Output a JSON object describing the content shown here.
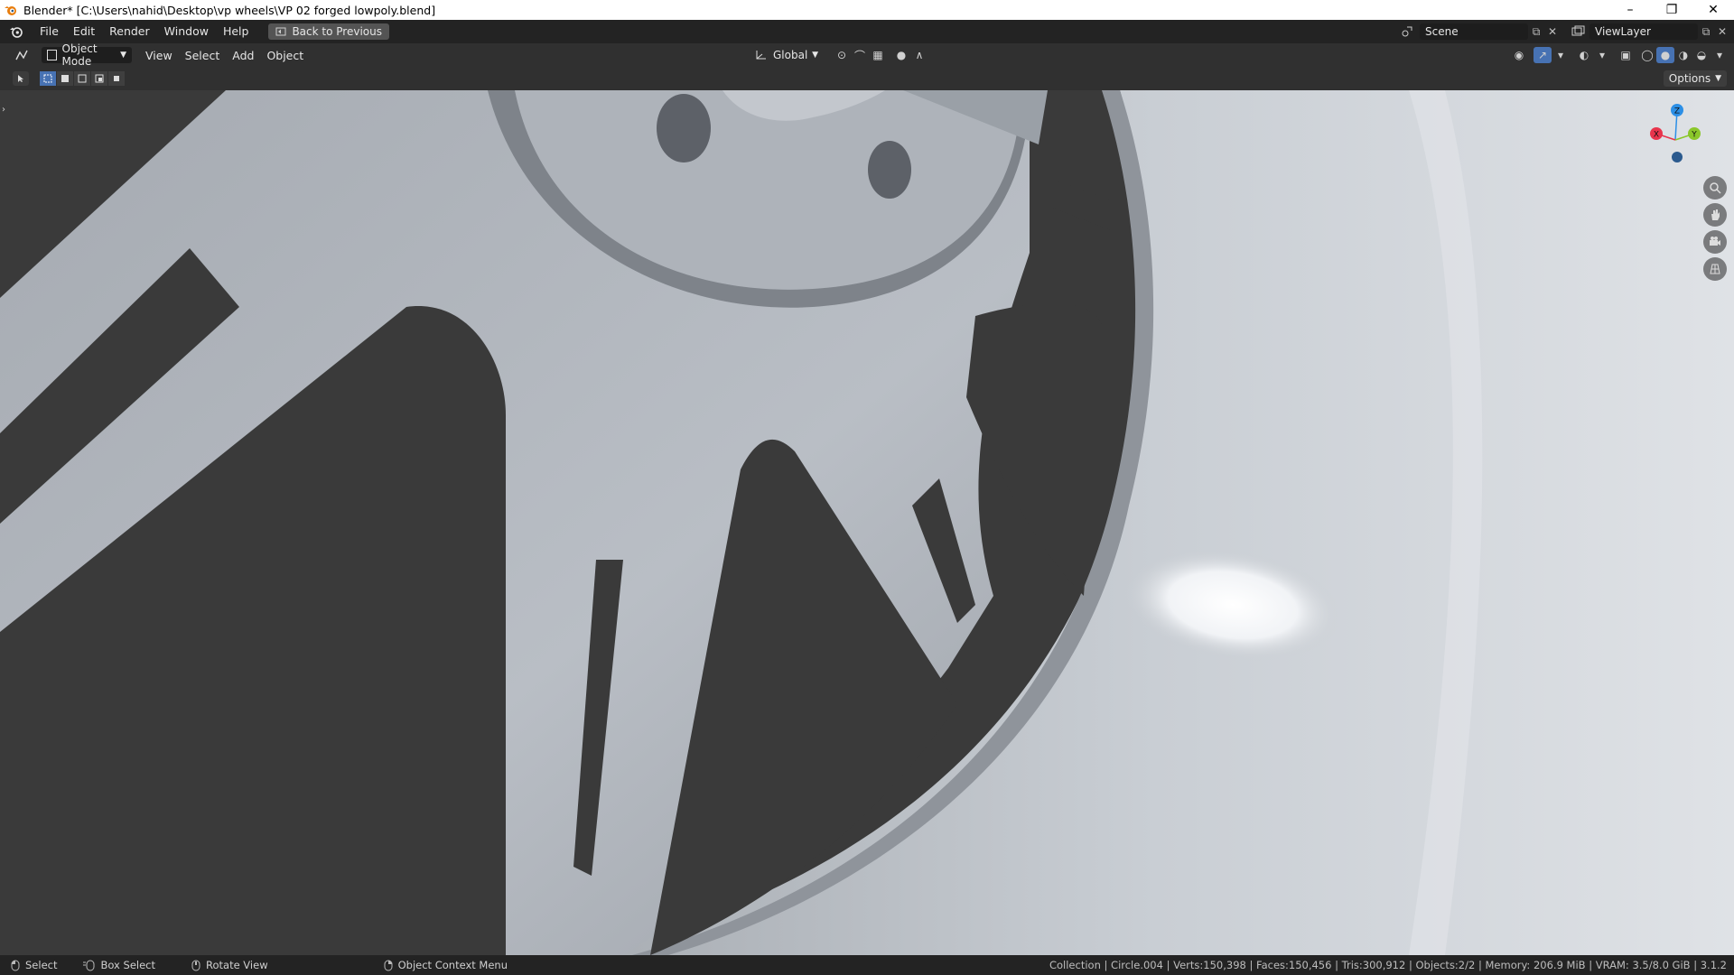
{
  "window": {
    "title": "Blender* [C:\\Users\\nahid\\Desktop\\vp wheels\\VP 02 forged lowpoly.blend]",
    "controls": [
      "–",
      "❐",
      "✕"
    ]
  },
  "menubar": {
    "items": [
      "File",
      "Edit",
      "Render",
      "Window",
      "Help"
    ],
    "back_button": "Back to Previous",
    "scene": "Scene",
    "view_layer": "ViewLayer"
  },
  "viewport_header": {
    "mode": "Object Mode",
    "menus": [
      "View",
      "Select",
      "Add",
      "Object"
    ],
    "transform_orientation": "Global"
  },
  "tool_header": {
    "options": "Options"
  },
  "gizmo": {
    "z": "Z",
    "y": "Y",
    "x": "X",
    "colors": {
      "x": "#e8344c",
      "y": "#8bc72b",
      "z": "#2c8fe6"
    }
  },
  "statusbar": {
    "select": "Select",
    "box_select": "Box Select",
    "rotate_view": "Rotate View",
    "context_menu": "Object Context Menu",
    "stats": "Collection | Circle.004 | Verts:150,398 | Faces:150,456 | Tris:300,912 | Objects:2/2 | Memory: 206.9 MiB | VRAM: 3.5/8.0 GiB | 3.1.2"
  },
  "colors": {
    "accent": "#4772b3",
    "header": "#303030",
    "topbar": "#232323"
  }
}
